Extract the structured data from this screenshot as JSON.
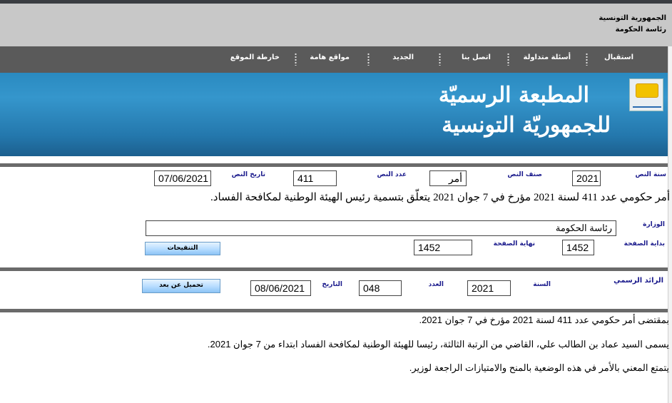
{
  "header": {
    "line1": "الجمهورية التونسية",
    "line2": "رئاسة الحكومة"
  },
  "nav": {
    "items": [
      "استقبال",
      "أسئلة متداولة",
      "اتصل بنا",
      "الجديد",
      "مواقع هامة",
      "خارطة الموقع"
    ]
  },
  "banner": {
    "title_line1": "المطبعة الرسميّة",
    "title_line2": "للجمهوريّة التونسية",
    "logo_icon": "official-printing-logo-icon"
  },
  "text_info": {
    "year_label": "سنة النص",
    "year_value": "2021",
    "type_label": "صنف النص",
    "type_value": "أمر",
    "number_label": "عدد النص",
    "number_value": "411",
    "date_label": "تاريخ النص",
    "date_value": "07/06/2021",
    "subject": "أمر حكومي عدد 411 لسنة 2021 مؤرخ في 7 جوان 2021 يتعلّق بتسمية رئيس الهيئة الوطنية لمكافحة الفساد.",
    "ministry_label": "الوزارة",
    "ministry_value": "رئاسة الحكومة",
    "page_start_label": "بداية الصفحة",
    "page_start_value": "1452",
    "page_end_label": "نهاية الصفحة",
    "page_end_value": "1452",
    "amendments_button": "التنقيحات"
  },
  "journal": {
    "label": "الرائد الرسمي",
    "year_label": "السنة",
    "year_value": "2021",
    "number_label": "العدد",
    "number_value": "048",
    "date_label": "التاريخ",
    "date_value": "08/06/2021",
    "download_button": "تحميل عن بعد"
  },
  "body": {
    "line1": "بمقتضى أمر حكومي عدد 411 لسنة 2021 مؤرخ في 7 جوان 2021.",
    "line2": "يسمى السيد عماد بن الطالب علي، القاضي من الرتبة الثالثة، رئيسا للهيئة الوطنية لمكافحة الفساد ابتداء من 7 جوان 2021.",
    "line3": "يتمتع المعني بالأمر في هذه الوضعية بالمنح والامتيازات الراجعة لوزير."
  }
}
